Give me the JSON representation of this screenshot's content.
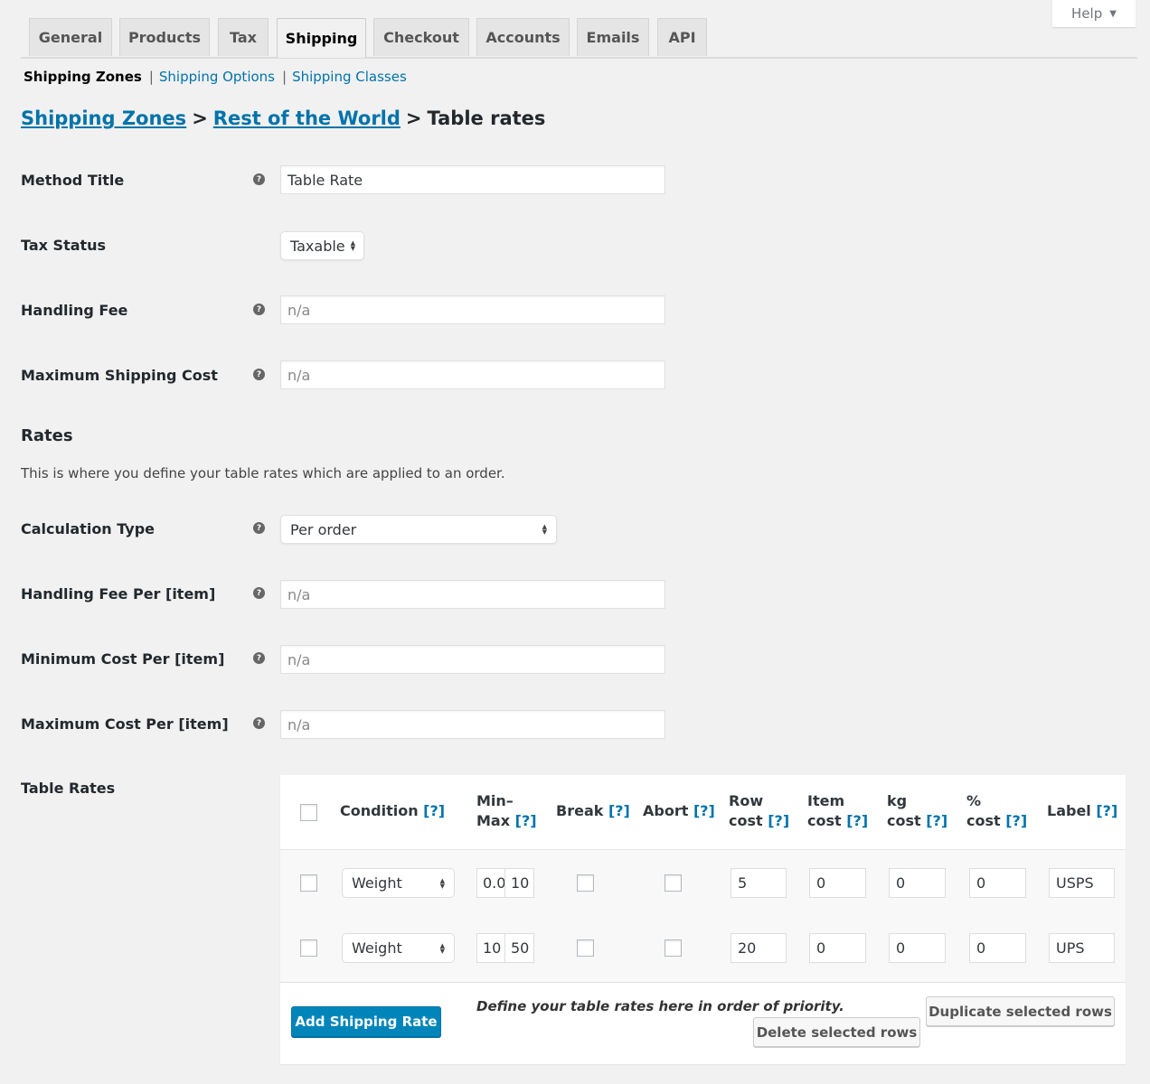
{
  "help": {
    "label": "Help",
    "icon": "caret-down-icon"
  },
  "tabs": [
    {
      "label": "General",
      "active": false
    },
    {
      "label": "Products",
      "active": false
    },
    {
      "label": "Tax",
      "active": false
    },
    {
      "label": "Shipping",
      "active": true
    },
    {
      "label": "Checkout",
      "active": false
    },
    {
      "label": "Accounts",
      "active": false
    },
    {
      "label": "Emails",
      "active": false
    },
    {
      "label": "API",
      "active": false
    }
  ],
  "subnav": {
    "current": "Shipping Zones",
    "links": [
      "Shipping Options",
      "Shipping Classes"
    ],
    "separator": "|"
  },
  "breadcrumb": {
    "links": [
      "Shipping Zones",
      "Rest of the World"
    ],
    "current": "Table rates",
    "separator": ">"
  },
  "fields": {
    "method_title": {
      "label": "Method Title",
      "value": "Table Rate",
      "has_tip": true
    },
    "tax_status": {
      "label": "Tax Status",
      "value": "Taxable",
      "has_tip": false
    },
    "handling_fee": {
      "label": "Handling Fee",
      "placeholder": "n/a",
      "has_tip": true
    },
    "max_shipping_cost": {
      "label": "Maximum Shipping Cost",
      "placeholder": "n/a",
      "has_tip": true
    },
    "calculation_type": {
      "label": "Calculation Type",
      "value": "Per order",
      "has_tip": true
    },
    "handling_fee_per": {
      "label": "Handling Fee Per [item]",
      "placeholder": "n/a",
      "has_tip": true
    },
    "min_cost_per": {
      "label": "Minimum Cost Per [item]",
      "placeholder": "n/a",
      "has_tip": true
    },
    "max_cost_per": {
      "label": "Maximum Cost Per [item]",
      "placeholder": "n/a",
      "has_tip": true
    }
  },
  "tip_glyph": "?",
  "rates_section": {
    "title": "Rates",
    "description": "This is where you define your table rates which are applied to an order."
  },
  "table_rates": {
    "label": "Table Rates",
    "help_marker": "[?]",
    "headers": {
      "condition": "Condition",
      "min": "Min–",
      "max": "Max",
      "break": "Break",
      "abort": "Abort",
      "row_a": "Row",
      "row_b": "cost",
      "item_a": "Item",
      "item_b": "cost",
      "kg_a": "kg",
      "kg_b": "cost",
      "pct_a": "%",
      "pct_b": "cost",
      "label": "Label"
    },
    "rows": [
      {
        "selected": false,
        "condition": "Weight",
        "min": "0.0",
        "max": "10",
        "break": false,
        "abort": false,
        "row_cost": "5",
        "item_cost": "0",
        "kg_cost": "0",
        "pct_cost": "0",
        "label": "USPS"
      },
      {
        "selected": false,
        "condition": "Weight",
        "min": "10",
        "max": "50",
        "break": false,
        "abort": false,
        "row_cost": "20",
        "item_cost": "0",
        "kg_cost": "0",
        "pct_cost": "0",
        "label": "UPS"
      }
    ],
    "add_button": "Add Shipping Rate",
    "note": "Define your table rates here in order of priority.",
    "duplicate_button": "Duplicate selected rows",
    "delete_button": "Delete selected rows"
  },
  "colors": {
    "link": "#0073aa",
    "primary_button": "#0085ba",
    "background": "#f1f1f1"
  }
}
